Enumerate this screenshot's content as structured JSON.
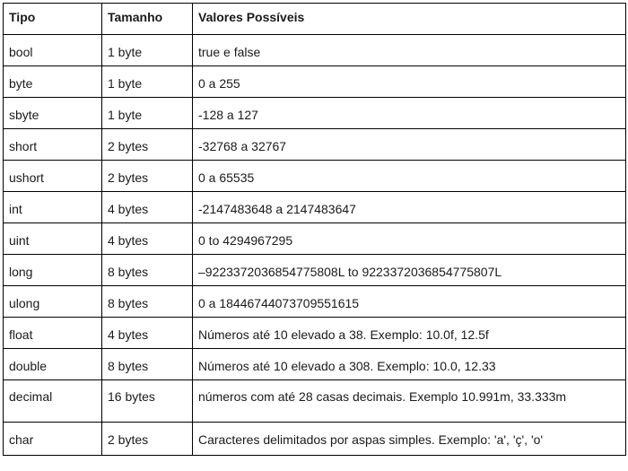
{
  "table": {
    "headers": [
      "Tipo",
      "Tamanho",
      "Valores Possíveis"
    ],
    "rows": [
      [
        "bool",
        "1 byte",
        "true e false"
      ],
      [
        "byte",
        "1 byte",
        "0 a 255"
      ],
      [
        "sbyte",
        "1 byte",
        "-128 a 127"
      ],
      [
        "short",
        "2 bytes",
        "-32768 a 32767"
      ],
      [
        "ushort",
        "2 bytes",
        "0 a 65535"
      ],
      [
        "int",
        "4 bytes",
        "-2147483648 a 2147483647"
      ],
      [
        "uint",
        "4 bytes",
        "0 to 4294967295"
      ],
      [
        "long",
        "8 bytes",
        "–9223372036854775808L to 9223372036854775807L"
      ],
      [
        "ulong",
        "8 bytes",
        "0 a 18446744073709551615"
      ],
      [
        "float",
        "4 bytes",
        "Números até 10 elevado a 38. Exemplo: 10.0f, 12.5f"
      ],
      [
        "double",
        "8 bytes",
        "Números até 10 elevado a 308. Exemplo: 10.0, 12.33"
      ],
      [
        "decimal",
        "16 bytes",
        "números com até 28 casas decimais. Exemplo 10.991m, 33.333m"
      ],
      [
        "char",
        "2 bytes",
        "Caracteres delimitados por aspas simples. Exemplo: 'a', 'ç', 'o'"
      ]
    ]
  },
  "colors": {
    "border": "#000000",
    "text": "#1a1a1a",
    "background": "#ffffff"
  }
}
